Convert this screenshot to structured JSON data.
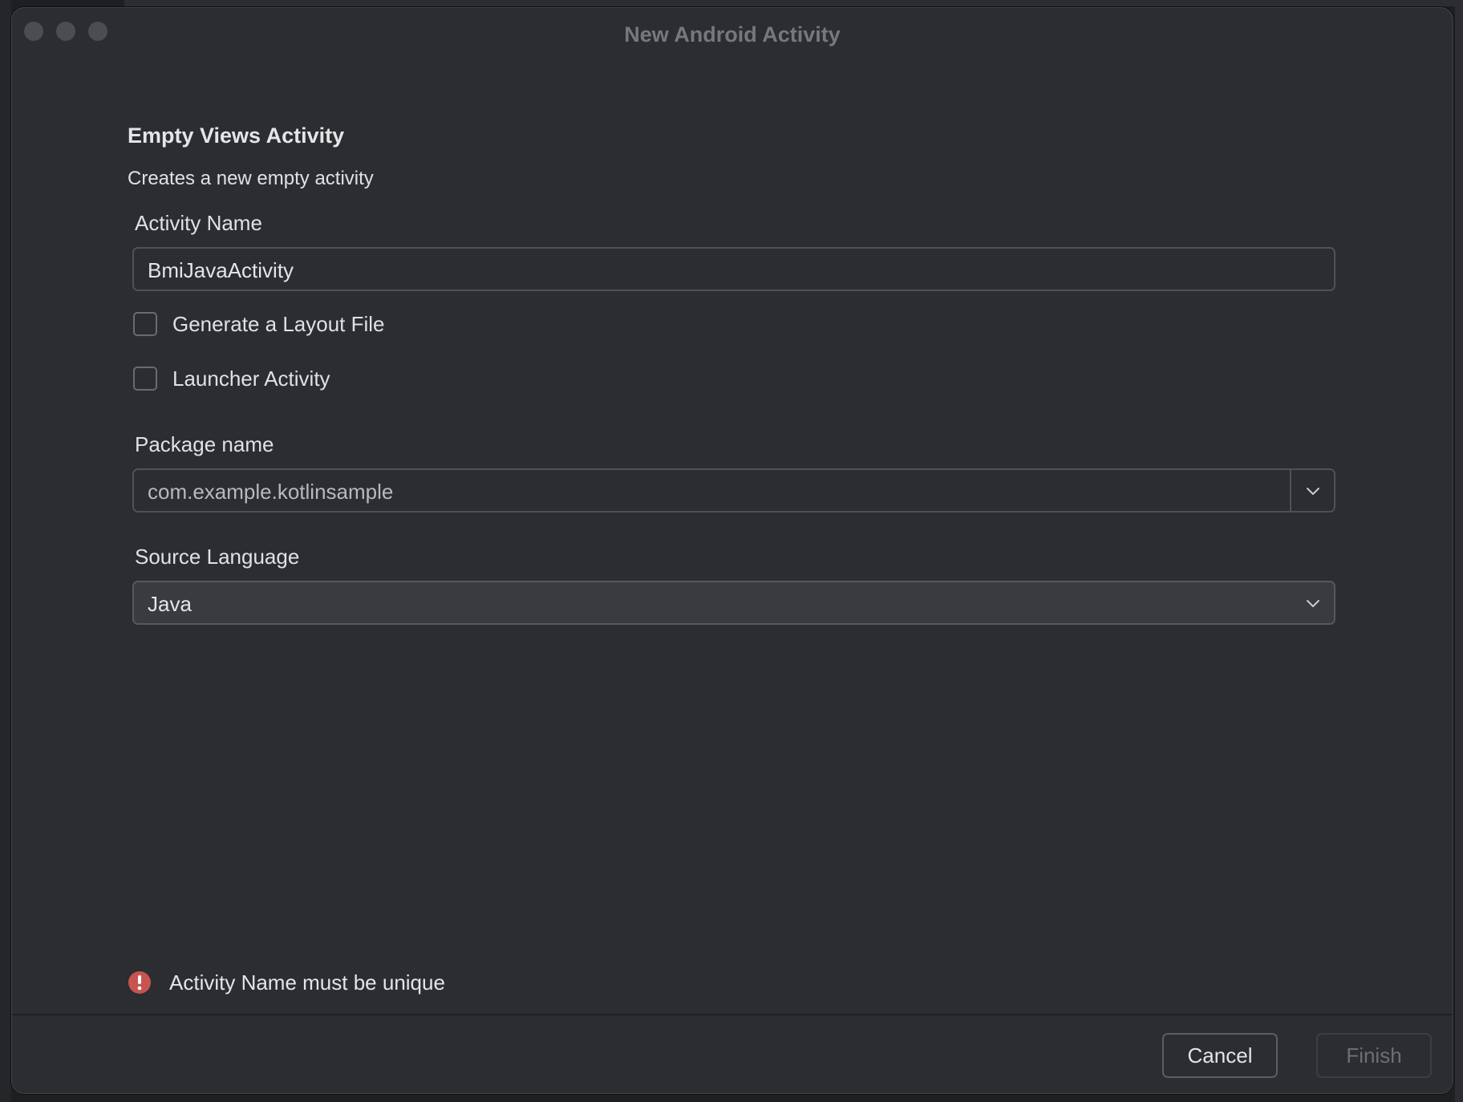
{
  "window": {
    "title": "New Android Activity"
  },
  "template": {
    "heading": "Empty Views Activity",
    "description": "Creates a new empty activity"
  },
  "form": {
    "activity_name_label": "Activity Name",
    "activity_name_value": "BmiJavaActivity",
    "generate_layout_label": "Generate a Layout File",
    "generate_layout_checked": false,
    "launcher_activity_label": "Launcher Activity",
    "launcher_activity_checked": false,
    "package_name_label": "Package name",
    "package_name_value": "com.example.kotlinsample",
    "source_language_label": "Source Language",
    "source_language_value": "Java"
  },
  "validation": {
    "message": "Activity Name must be unique",
    "icon": "error-icon",
    "color": "#c75450"
  },
  "footer": {
    "cancel_label": "Cancel",
    "finish_label": "Finish"
  }
}
